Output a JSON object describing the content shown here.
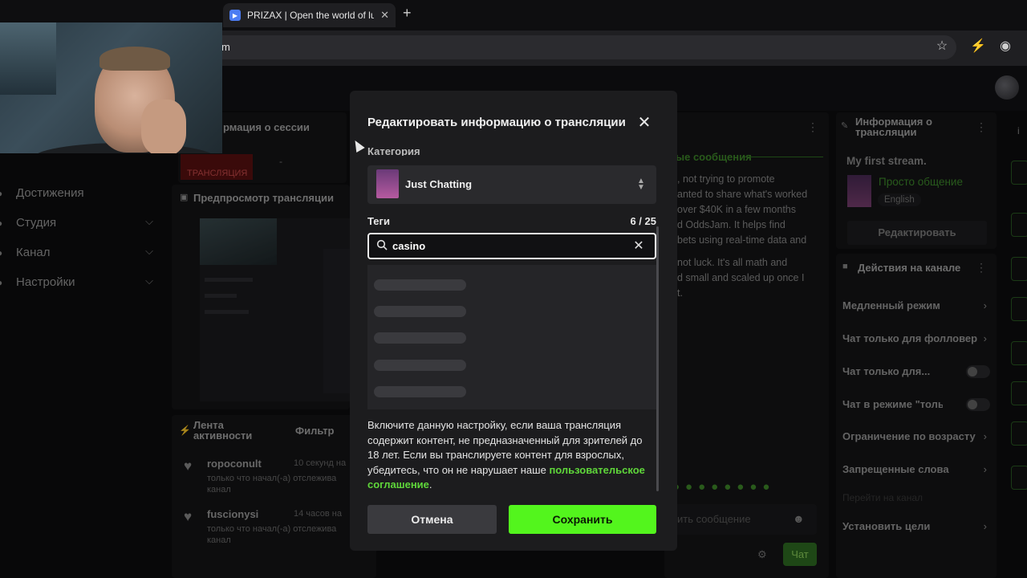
{
  "browser": {
    "tab_title": "PRIZAX | Open the world of lu",
    "tab_close": "✕",
    "new_tab": "+",
    "url_fragment": "m"
  },
  "sidebar": {
    "items": [
      {
        "label": "Достижения",
        "has_chevron": false
      },
      {
        "label": "Студия",
        "has_chevron": true
      },
      {
        "label": "Канал",
        "has_chevron": true
      },
      {
        "label": "Настройки",
        "has_chevron": true
      }
    ]
  },
  "session_panel": {
    "title": "рмация о сессии",
    "live_label": "ТРАНСЛЯЦИЯ",
    "dash": "-"
  },
  "preview_panel": {
    "title": "Предпросмотр трансляции"
  },
  "activity_panel": {
    "title": "Лента активности",
    "filter_label": "Фильтр",
    "items": [
      {
        "name": "ropoconult",
        "time": "10 секунд на",
        "text": "только что начал(-а) отслежива канал"
      },
      {
        "name": "fuscionysi",
        "time": "14 часов на",
        "text": "только что начал(-а) отслежива канал"
      }
    ]
  },
  "chat_panel": {
    "pinned_label": "ые сообщения",
    "message_lines": [
      ", not trying to promote",
      "anted to share what's worked",
      "over $40K in a few months",
      "d OddsJam. It helps find",
      "bets using real-time data and",
      "",
      "not luck. It's all math and",
      "d small and scaled up once I",
      "t."
    ],
    "input_placeholder": "ить сообщение",
    "send_label": "Чат"
  },
  "info_panel": {
    "title": "Информация о трансляции",
    "stream_title": "My first stream.",
    "category": "Просто общение",
    "language": "English",
    "edit_label": "Редактировать"
  },
  "actions_panel": {
    "title": "Действия на канале",
    "rows": [
      {
        "label": "Медленный режим",
        "control": "chevron"
      },
      {
        "label": "Чат только для фолловер",
        "control": "chevron"
      },
      {
        "label": "Чат только для...",
        "control": "toggle"
      },
      {
        "label": "Чат в режиме \"тольк...",
        "control": "toggle"
      },
      {
        "label": "Ограничение по возрасту",
        "control": "chevron"
      },
      {
        "label": "Запрещенные слова",
        "control": "chevron"
      },
      {
        "label": "Перейти на канал",
        "control": "none"
      },
      {
        "label": "Установить цели",
        "control": "chevron"
      }
    ]
  },
  "modal": {
    "title": "Редактировать информацию о трансляции",
    "category_label": "Категория",
    "category_value": "Just Chatting",
    "tags_label": "Теги",
    "tags_count": "6 / 25",
    "search_value": "casino",
    "mature_text": "Включите данную настройку, если ваша трансляция содержит контент, не предназначенный для зрителей до 18 лет. Если вы транслируете контент для взрослых, убедитесь, что он не нарушает наше ",
    "agreement_link": "пользовательское соглашение",
    "period": ".",
    "cancel_label": "Отмена",
    "save_label": "Сохранить"
  },
  "colors": {
    "accent_green": "#53f51d",
    "link_green": "#5fd73a",
    "modal_bg": "#1c1c1e"
  }
}
